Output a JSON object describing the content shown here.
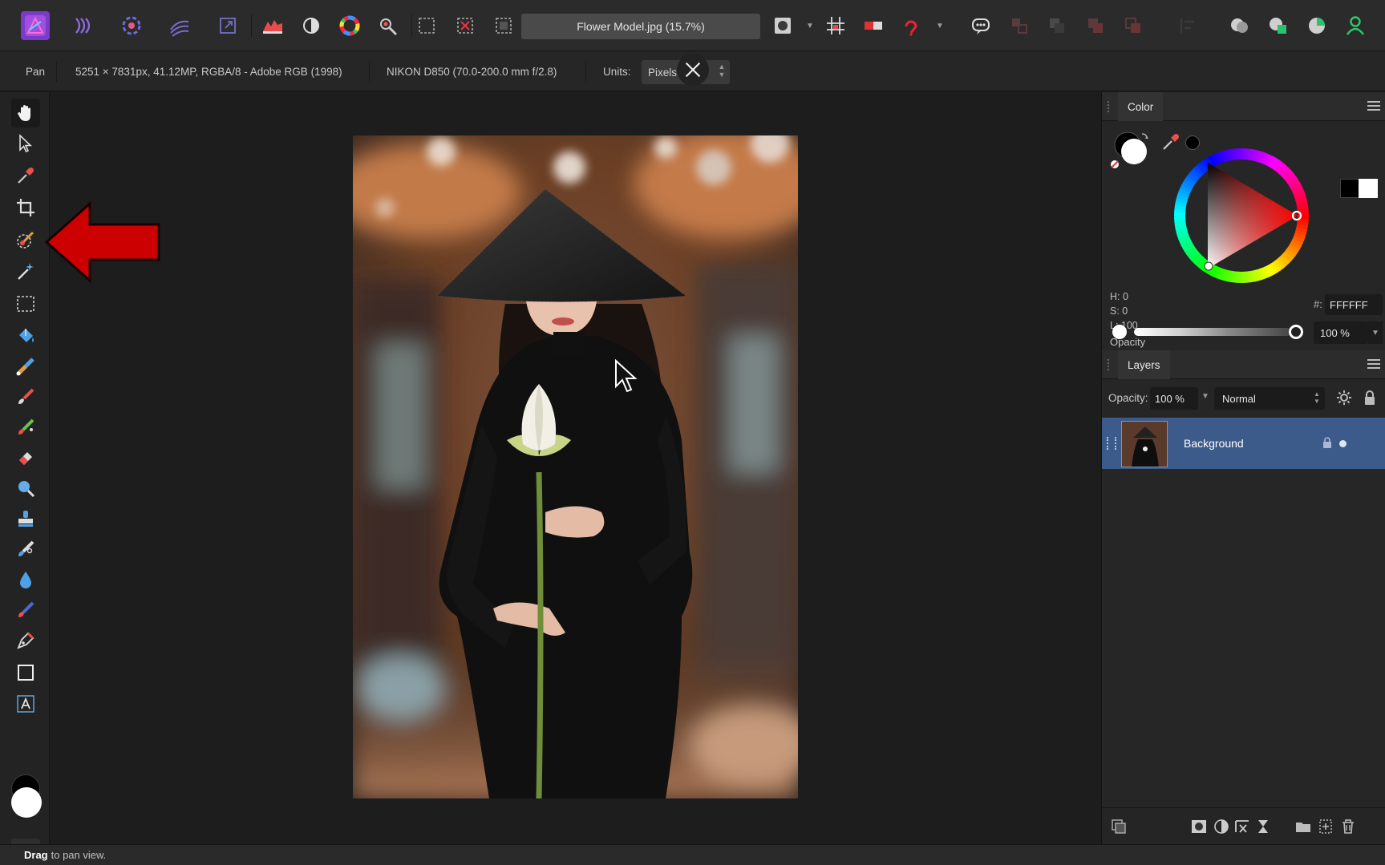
{
  "window": {
    "document_title": "Flower Model.jpg (15.7%)"
  },
  "context_bar": {
    "tool_name": "Pan",
    "image_info": "5251 × 7831px, 41.12MP, RGBA/8 - Adobe RGB (1998)",
    "camera_info": "NIKON D850 (70.0-200.0 mm f/2.8)",
    "units_label": "Units:",
    "units_value": "Pixels"
  },
  "toolbar": {
    "persona_icons": [
      "photo-persona-icon",
      "liquify-persona-icon",
      "develop-persona-icon",
      "tone-mapping-persona-icon",
      "export-persona-icon"
    ],
    "quick_icons": [
      "levels-icon",
      "auto-contrast-icon",
      "color-wheel-icon",
      "auto-white-balance-icon",
      "selection-icon",
      "deselect-icon",
      "invert-selection-icon"
    ]
  },
  "tools": [
    {
      "name": "view-tool",
      "icon": "hand-icon",
      "active": true
    },
    {
      "name": "move-tool",
      "icon": "arrow-pointer-icon"
    },
    {
      "name": "color-picker-tool",
      "icon": "eyedropper-icon"
    },
    {
      "name": "crop-tool",
      "icon": "crop-icon"
    },
    {
      "name": "selection-brush-tool",
      "icon": "selection-brush-icon"
    },
    {
      "name": "flood-select-tool",
      "icon": "magic-wand-icon"
    },
    {
      "name": "marquee-tool",
      "icon": "marquee-icon"
    },
    {
      "name": "flood-fill-tool",
      "icon": "paint-bucket-icon"
    },
    {
      "name": "gradient-tool",
      "icon": "gradient-icon"
    },
    {
      "name": "paint-brush-tool",
      "icon": "brush-icon"
    },
    {
      "name": "dodge-brush-tool",
      "icon": "dodge-brush-icon"
    },
    {
      "name": "erase-brush-tool",
      "icon": "eraser-icon"
    },
    {
      "name": "blur-brush-tool",
      "icon": "magnifier-icon"
    },
    {
      "name": "clone-brush-tool",
      "icon": "stamp-icon"
    },
    {
      "name": "inpainting-tool",
      "icon": "inpaint-brush-icon"
    },
    {
      "name": "blur-drop-tool",
      "icon": "drop-icon"
    },
    {
      "name": "red-eye-tool",
      "icon": "red-eye-brush-icon"
    },
    {
      "name": "pen-tool",
      "icon": "pen-nib-icon"
    },
    {
      "name": "rectangle-tool",
      "icon": "rectangle-icon"
    },
    {
      "name": "text-tool",
      "icon": "text-a-icon"
    }
  ],
  "color_panel": {
    "tab_label": "Color",
    "hue": "H: 0",
    "saturation": "S: 0",
    "lightness": "L: 100",
    "opacity_label": "Opacity",
    "hex_label": "#:",
    "hex_value": "FFFFFF",
    "opacity_value": "100 %",
    "opacity_level": 1.0,
    "primary_color": "#000000",
    "secondary_color": "#FFFFFF"
  },
  "layers_panel": {
    "tab_label": "Layers",
    "opacity_label": "Opacity:",
    "opacity_value": "100 %",
    "blend_mode": "Normal",
    "layers": [
      {
        "name": "Background",
        "selected": true,
        "locked": true,
        "visible": true
      }
    ]
  },
  "status": {
    "bold": "Drag",
    "text": "to pan view."
  },
  "colors": {
    "accent_layer_selected": "#3c5a8a",
    "annotation_arrow": "#cc0000",
    "app_icon": "#9b3fcf"
  }
}
